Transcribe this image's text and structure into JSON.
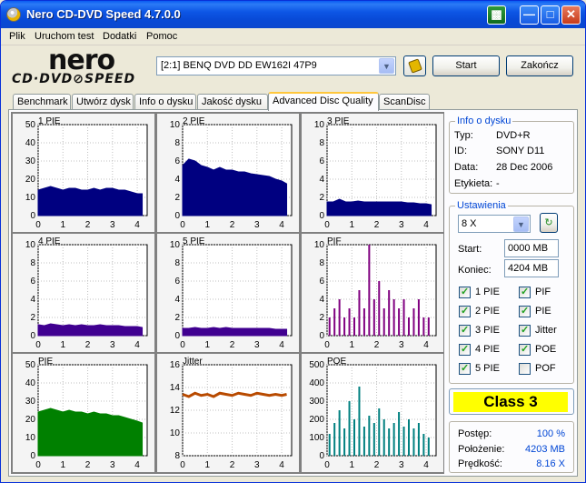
{
  "window": {
    "title": "Nero CD-DVD Speed 4.7.0.0"
  },
  "menu": [
    "Plik",
    "Uruchom test",
    "Dodatki",
    "Pomoc"
  ],
  "logo": {
    "nero": "nero",
    "cddvd": "CD·DVD⊘SPEED"
  },
  "toolbar": {
    "drive": "[2:1]   BENQ DVD DD EW162I 47P9",
    "start_label": "Start",
    "end_label": "Zakończ"
  },
  "tabs": [
    "Benchmark",
    "Utwórz dysk",
    "Info o dysku",
    "Jakość dysku",
    "Advanced Disc Quality",
    "ScanDisc"
  ],
  "active_tab": "Advanced Disc Quality",
  "disc_info": {
    "legend": "Info o dysku",
    "rows": [
      {
        "label": "Typ:",
        "value": "DVD+R"
      },
      {
        "label": "ID:",
        "value": "SONY D11"
      },
      {
        "label": "Data:",
        "value": "28 Dec 2006"
      },
      {
        "label": "Etykieta:",
        "value": "-"
      }
    ]
  },
  "settings": {
    "legend": "Ustawienia",
    "speed": "8 X",
    "start_label": "Start:",
    "start_value": "0000 MB",
    "end_label": "Koniec:",
    "end_value": "4204 MB",
    "checks": [
      {
        "label": "1 PIE",
        "checked": true
      },
      {
        "label": "PIF",
        "checked": true
      },
      {
        "label": "2 PIE",
        "checked": true
      },
      {
        "label": "PIE",
        "checked": true
      },
      {
        "label": "3 PIE",
        "checked": true
      },
      {
        "label": "Jitter",
        "checked": true
      },
      {
        "label": "4 PIE",
        "checked": true
      },
      {
        "label": "POE",
        "checked": true
      },
      {
        "label": "5 PIE",
        "checked": true
      },
      {
        "label": "POF",
        "checked": false
      }
    ]
  },
  "result": {
    "class": "Class 3"
  },
  "status": {
    "rows": [
      {
        "label": "Postęp:",
        "value": "100 %"
      },
      {
        "label": "Położenie:",
        "value": "4203 MB"
      },
      {
        "label": "Prędkość:",
        "value": "8.16 X"
      }
    ]
  },
  "colors": {
    "navy": "#000080",
    "purple": "#800080",
    "green": "#008000",
    "brown": "#b84a00",
    "teal": "#008080",
    "class_bg": "#ffff00"
  },
  "chart_data": [
    {
      "type": "area",
      "title": "1 PIE",
      "color": "#000080",
      "ylim": [
        0,
        50
      ],
      "yticks": [
        0,
        10,
        20,
        30,
        40,
        50
      ],
      "xticks": [
        0,
        1,
        2,
        3,
        4
      ],
      "x": [
        0,
        0.25,
        0.5,
        0.75,
        1,
        1.25,
        1.5,
        1.75,
        2,
        2.25,
        2.5,
        2.75,
        3,
        3.25,
        3.5,
        3.75,
        4,
        4.2
      ],
      "y": [
        14,
        15,
        16,
        15,
        14,
        15,
        15,
        14,
        14,
        15,
        14,
        15,
        15,
        14,
        14,
        13,
        12,
        12
      ]
    },
    {
      "type": "area",
      "title": "2 PIE",
      "color": "#000080",
      "ylim": [
        0,
        10
      ],
      "yticks": [
        0,
        2,
        4,
        6,
        8,
        10
      ],
      "xticks": [
        0,
        1,
        2,
        3,
        4
      ],
      "x": [
        0,
        0.25,
        0.5,
        0.75,
        1,
        1.25,
        1.5,
        1.75,
        2,
        2.25,
        2.5,
        2.75,
        3,
        3.25,
        3.5,
        3.75,
        4,
        4.2
      ],
      "y": [
        5.5,
        6.2,
        6,
        5.5,
        5.3,
        5,
        5.3,
        5,
        5,
        4.8,
        4.8,
        4.6,
        4.5,
        4.4,
        4.3,
        4,
        3.8,
        3.5
      ]
    },
    {
      "type": "area",
      "title": "3 PIE",
      "color": "#000080",
      "ylim": [
        0,
        10
      ],
      "yticks": [
        0,
        2,
        4,
        6,
        8,
        10
      ],
      "xticks": [
        0,
        1,
        2,
        3,
        4
      ],
      "x": [
        0,
        0.25,
        0.5,
        0.75,
        1,
        1.25,
        1.5,
        1.75,
        2,
        2.25,
        2.5,
        2.75,
        3,
        3.25,
        3.5,
        3.75,
        4,
        4.2
      ],
      "y": [
        1.5,
        1.5,
        1.8,
        1.5,
        1.5,
        1.6,
        1.5,
        1.5,
        1.5,
        1.5,
        1.5,
        1.5,
        1.5,
        1.4,
        1.4,
        1.3,
        1.3,
        1.2
      ]
    },
    {
      "type": "area",
      "title": "4 PIE",
      "color": "#400090",
      "ylim": [
        0,
        10
      ],
      "yticks": [
        0,
        2,
        4,
        6,
        8,
        10
      ],
      "xticks": [
        0,
        1,
        2,
        3,
        4
      ],
      "x": [
        0,
        0.25,
        0.5,
        0.75,
        1,
        1.25,
        1.5,
        1.75,
        2,
        2.25,
        2.5,
        2.75,
        3,
        3.25,
        3.5,
        3.75,
        4,
        4.2
      ],
      "y": [
        1.2,
        1.1,
        1.3,
        1.2,
        1.1,
        1.2,
        1.1,
        1.2,
        1.1,
        1.1,
        1.2,
        1.1,
        1.1,
        1.1,
        1.0,
        1.0,
        1.0,
        0.9
      ]
    },
    {
      "type": "area",
      "title": "5 PIE",
      "color": "#400090",
      "ylim": [
        0,
        10
      ],
      "yticks": [
        0,
        2,
        4,
        6,
        8,
        10
      ],
      "xticks": [
        0,
        1,
        2,
        3,
        4
      ],
      "x": [
        0,
        0.25,
        0.5,
        0.75,
        1,
        1.25,
        1.5,
        1.75,
        2,
        2.25,
        2.5,
        2.75,
        3,
        3.25,
        3.5,
        3.75,
        4,
        4.2
      ],
      "y": [
        0.8,
        0.8,
        0.9,
        0.8,
        0.8,
        0.9,
        0.8,
        0.9,
        0.8,
        0.8,
        0.8,
        0.8,
        0.8,
        0.8,
        0.8,
        0.7,
        0.7,
        0.7
      ]
    },
    {
      "type": "bar",
      "title": "PIF",
      "color": "#800080",
      "ylim": [
        0,
        10
      ],
      "yticks": [
        0,
        2,
        4,
        6,
        8,
        10
      ],
      "xticks": [
        0,
        1,
        2,
        3,
        4
      ],
      "x": [
        0.1,
        0.3,
        0.5,
        0.7,
        0.9,
        1.1,
        1.3,
        1.5,
        1.7,
        1.9,
        2.1,
        2.3,
        2.5,
        2.7,
        2.9,
        3.1,
        3.3,
        3.5,
        3.7,
        3.9,
        4.1
      ],
      "y": [
        2,
        3,
        4,
        2,
        3,
        2,
        5,
        3,
        10,
        4,
        6,
        3,
        5,
        4,
        3,
        4,
        2,
        3,
        4,
        2,
        2
      ]
    },
    {
      "type": "area",
      "title": "PIE",
      "color": "#008000",
      "ylim": [
        0,
        50
      ],
      "yticks": [
        0,
        10,
        20,
        30,
        40,
        50
      ],
      "xticks": [
        0,
        1,
        2,
        3,
        4
      ],
      "x": [
        0,
        0.25,
        0.5,
        0.75,
        1,
        1.25,
        1.5,
        1.75,
        2,
        2.25,
        2.5,
        2.75,
        3,
        3.25,
        3.5,
        3.75,
        4,
        4.2
      ],
      "y": [
        24,
        25,
        26,
        25,
        24,
        25,
        24,
        24,
        23,
        24,
        23,
        23,
        22,
        22,
        21,
        20,
        19,
        18
      ]
    },
    {
      "type": "line",
      "title": "Jitter",
      "color": "#b84a00",
      "ylim": [
        8,
        16
      ],
      "yticks": [
        8,
        10,
        12,
        14,
        16
      ],
      "xticks": [
        0,
        1,
        2,
        3,
        4
      ],
      "x": [
        0,
        0.25,
        0.5,
        0.75,
        1,
        1.25,
        1.5,
        1.75,
        2,
        2.25,
        2.5,
        2.75,
        3,
        3.25,
        3.5,
        3.75,
        4,
        4.2
      ],
      "y": [
        13.4,
        13.2,
        13.5,
        13.3,
        13.4,
        13.2,
        13.5,
        13.4,
        13.3,
        13.5,
        13.4,
        13.3,
        13.5,
        13.4,
        13.3,
        13.4,
        13.3,
        13.4
      ]
    },
    {
      "type": "bar",
      "title": "POE",
      "color": "#008080",
      "ylim": [
        0,
        500
      ],
      "yticks": [
        0,
        100,
        200,
        300,
        400,
        500
      ],
      "xticks": [
        0,
        1,
        2,
        3,
        4
      ],
      "x": [
        0.1,
        0.3,
        0.5,
        0.7,
        0.9,
        1.1,
        1.3,
        1.5,
        1.7,
        1.9,
        2.1,
        2.3,
        2.5,
        2.7,
        2.9,
        3.1,
        3.3,
        3.5,
        3.7,
        3.9,
        4.1
      ],
      "y": [
        120,
        180,
        250,
        150,
        300,
        200,
        380,
        160,
        220,
        180,
        260,
        200,
        150,
        180,
        240,
        160,
        200,
        150,
        180,
        120,
        100
      ]
    }
  ]
}
